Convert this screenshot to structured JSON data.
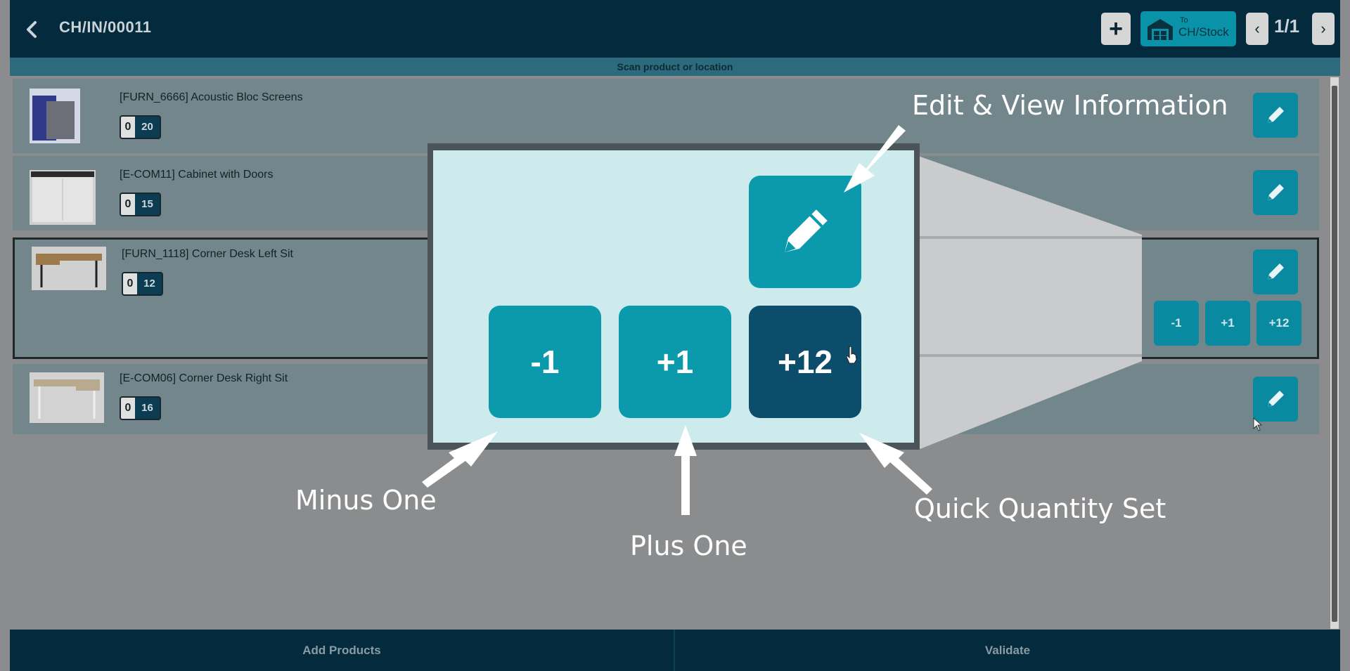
{
  "header": {
    "title": "CH/IN/00011",
    "destination_prefix": "To",
    "destination": "CH/Stock",
    "pager": "1/1"
  },
  "scan_hint": "Scan product or location",
  "products": [
    {
      "name": "[FURN_6666] Acoustic Bloc Screens",
      "done": "0",
      "total": "20"
    },
    {
      "name": "[E-COM11] Cabinet with Doors",
      "done": "0",
      "total": "15"
    },
    {
      "name": "[FURN_1118] Corner Desk Left Sit",
      "done": "0",
      "total": "12"
    },
    {
      "name": "[E-COM06] Corner Desk Right Sit",
      "done": "0",
      "total": "16"
    }
  ],
  "row_actions": {
    "minus": "-1",
    "plus": "+1",
    "set": "+12"
  },
  "footer": {
    "add_products": "Add Products",
    "validate": "Validate"
  },
  "callouts": {
    "edit": "Edit & View Information",
    "minus": "Minus One",
    "plus": "Plus One",
    "quick": "Quick Quantity Set"
  },
  "colors": {
    "header": "#042a3d",
    "accent": "#0a8aa0",
    "dark_accent": "#0b4d6b",
    "overlay_bg": "#cdebed"
  }
}
